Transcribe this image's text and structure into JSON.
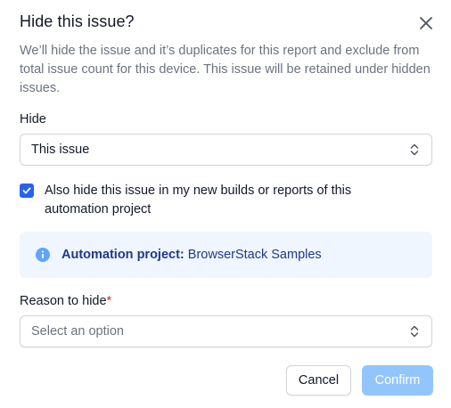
{
  "dialog": {
    "title": "Hide this issue?",
    "description": "We’ll hide the issue and it’s duplicates for this report and exclude from total issue count for this device. This issue will be retained under hidden issues."
  },
  "hide_field": {
    "label": "Hide",
    "selected_value": "This issue"
  },
  "checkbox": {
    "checked": true,
    "label": "Also hide this issue in my new builds or reports of this automation project"
  },
  "info": {
    "label": "Automation project:",
    "value": "BrowserStack Samples"
  },
  "reason_field": {
    "label": "Reason to hide",
    "required_marker": "*",
    "placeholder": "Select an option"
  },
  "buttons": {
    "cancel": "Cancel",
    "confirm": "Confirm"
  },
  "icons": {
    "close": "close-icon",
    "select_chevron": "chevron-up-down-icon",
    "checkbox_check": "check-icon",
    "info": "info-icon"
  },
  "colors": {
    "accent": "#2563eb",
    "info_background": "#eff6ff",
    "info_text": "#1e3a8a",
    "required": "#dc2626",
    "confirm_disabled": "#93c5fd"
  }
}
